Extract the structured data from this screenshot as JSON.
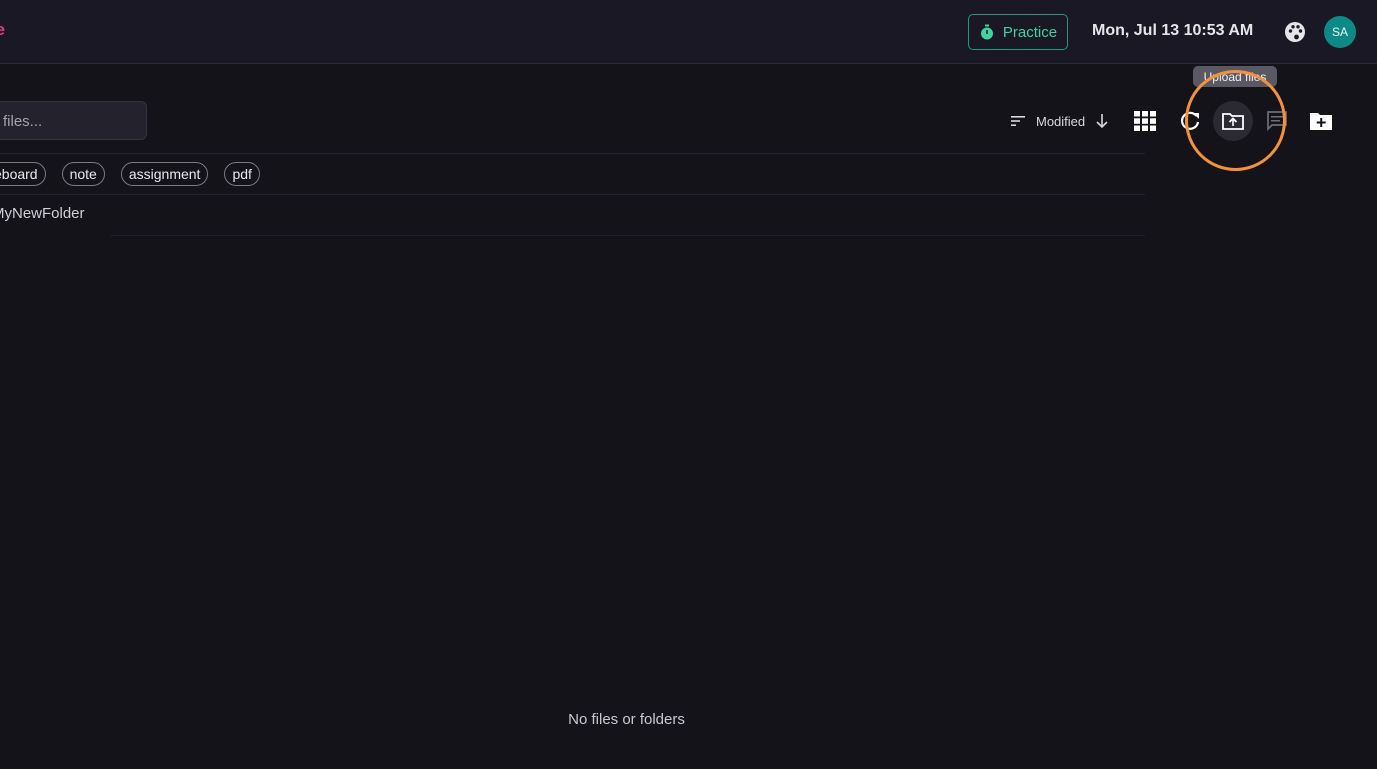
{
  "header": {
    "brand": "ve",
    "practice_label": "Practice",
    "datetime": "Mon, Jul 13 10:53 AM",
    "avatar_initials": "SA"
  },
  "search": {
    "placeholder": "ch files..."
  },
  "toolbar": {
    "sort_label": "Modified",
    "tooltip": "Upload files"
  },
  "filters": [
    "eboard",
    "note",
    "assignment",
    "pdf"
  ],
  "folders": [
    {
      "name": "MyNewFolder"
    }
  ],
  "empty_state": "No files or folders",
  "colors": {
    "background": "#14131a",
    "accent_brand": "#e0407a",
    "practice_green": "#3ed3a0",
    "avatar_teal": "#0e8a86",
    "highlight_orange": "#f4923c"
  }
}
